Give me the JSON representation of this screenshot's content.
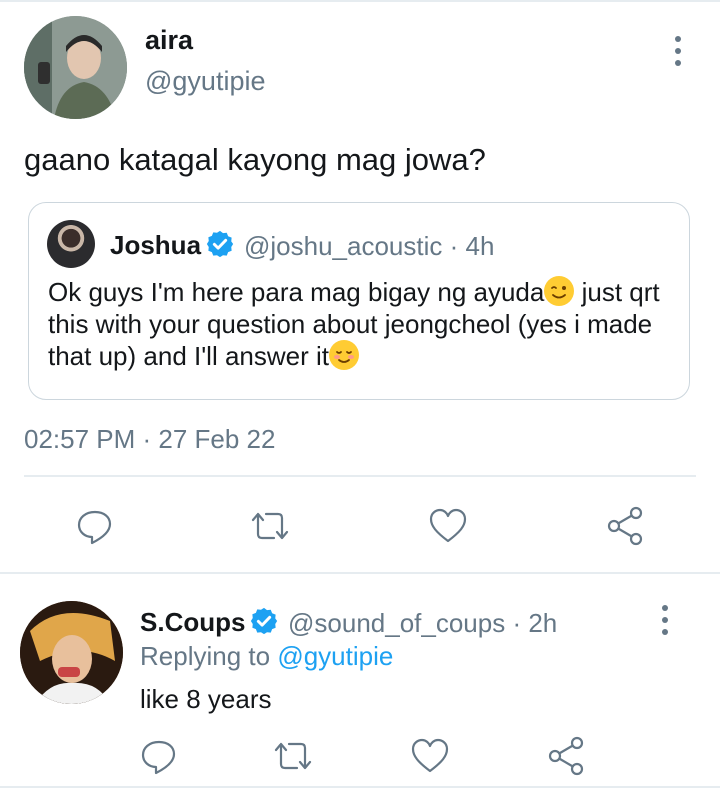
{
  "tweet": {
    "author_name": "aira",
    "author_handle": "@gyutipie",
    "text": "gaano katagal kayong mag jowa?",
    "timestamp": "02:57 PM · 27 Feb 22",
    "more_icon": "more-vertical-icon"
  },
  "quoted": {
    "author_name": "Joshua",
    "author_handle": "@joshu_acoustic",
    "time": "4h",
    "verified": true,
    "text_1": "Ok guys I'm here para mag bigay ng ayuda",
    "text_2": " just qrt this with your question about jeongcheol (yes i made that up) and I'll answer it"
  },
  "actions": [
    "reply-icon",
    "retweet-icon",
    "like-icon",
    "share-icon"
  ],
  "reply": {
    "author_name": "S.Coups",
    "author_handle": "@sound_of_coups",
    "time": "2h",
    "verified": true,
    "replying_prefix": "Replying to ",
    "replying_to": "@gyutipie",
    "text": "like 8 years"
  },
  "colors": {
    "accent": "#1da1f2",
    "muted": "#657786",
    "border": "#ccd6dd",
    "divider": "#e6ecf0"
  }
}
